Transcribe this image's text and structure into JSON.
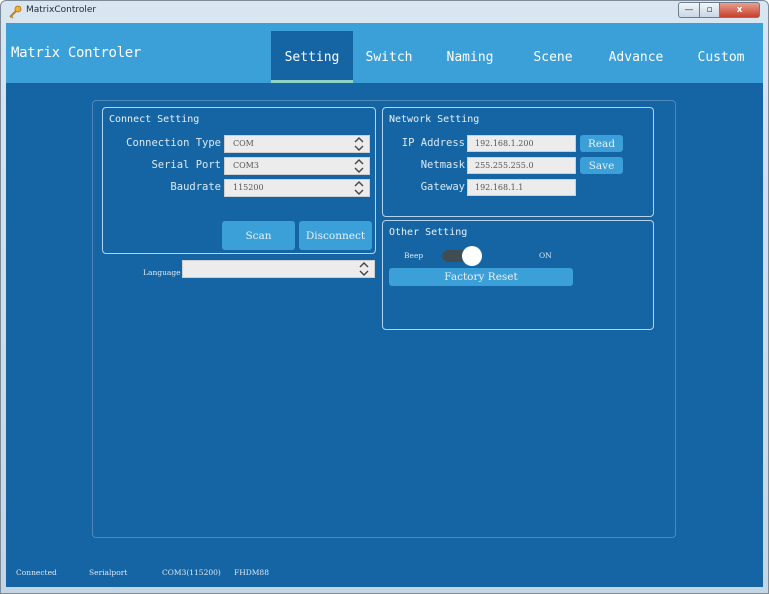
{
  "window": {
    "title": "MatrixControler",
    "controls": {
      "minimize": "—",
      "maximize": "▫",
      "close": "x"
    }
  },
  "header": {
    "app_title": "Matrix Controler",
    "tabs": [
      {
        "label": "Setting",
        "active": true
      },
      {
        "label": "Switch",
        "active": false
      },
      {
        "label": "Naming",
        "active": false
      },
      {
        "label": "Scene",
        "active": false
      },
      {
        "label": "Advance",
        "active": false
      },
      {
        "label": "Custom",
        "active": false
      }
    ]
  },
  "connect_setting": {
    "title": "Connect Setting",
    "connection_type": {
      "label": "Connection Type",
      "value": "COM"
    },
    "serial_port": {
      "label": "Serial Port",
      "value": "COM3"
    },
    "baudrate": {
      "label": "Baudrate",
      "value": "115200"
    },
    "scan_label": "Scan",
    "disconnect_label": "Disconnect"
  },
  "language": {
    "label": "Language",
    "value": ""
  },
  "network_setting": {
    "title": "Network Setting",
    "ip_address": {
      "label": "IP Address",
      "value": "192.168.1.200"
    },
    "netmask": {
      "label": "Netmask",
      "value": "255.255.255.0"
    },
    "gateway": {
      "label": "Gateway",
      "value": "192.168.1.1"
    },
    "read_label": "Read",
    "save_label": "Save"
  },
  "other_setting": {
    "title": "Other Setting",
    "beep_label": "Beep",
    "beep_state": "ON",
    "beep_on": true,
    "factory_reset_label": "Factory Reset"
  },
  "status_bar": {
    "connection": "Connected",
    "port_type": "Serialport",
    "port": "COM3(115200)",
    "device": "FHDM88"
  },
  "colors": {
    "header": "#3b9fd8",
    "background": "#1565a5",
    "active_tab_underline": "#8fd3c6",
    "button": "#3b9fd8"
  }
}
